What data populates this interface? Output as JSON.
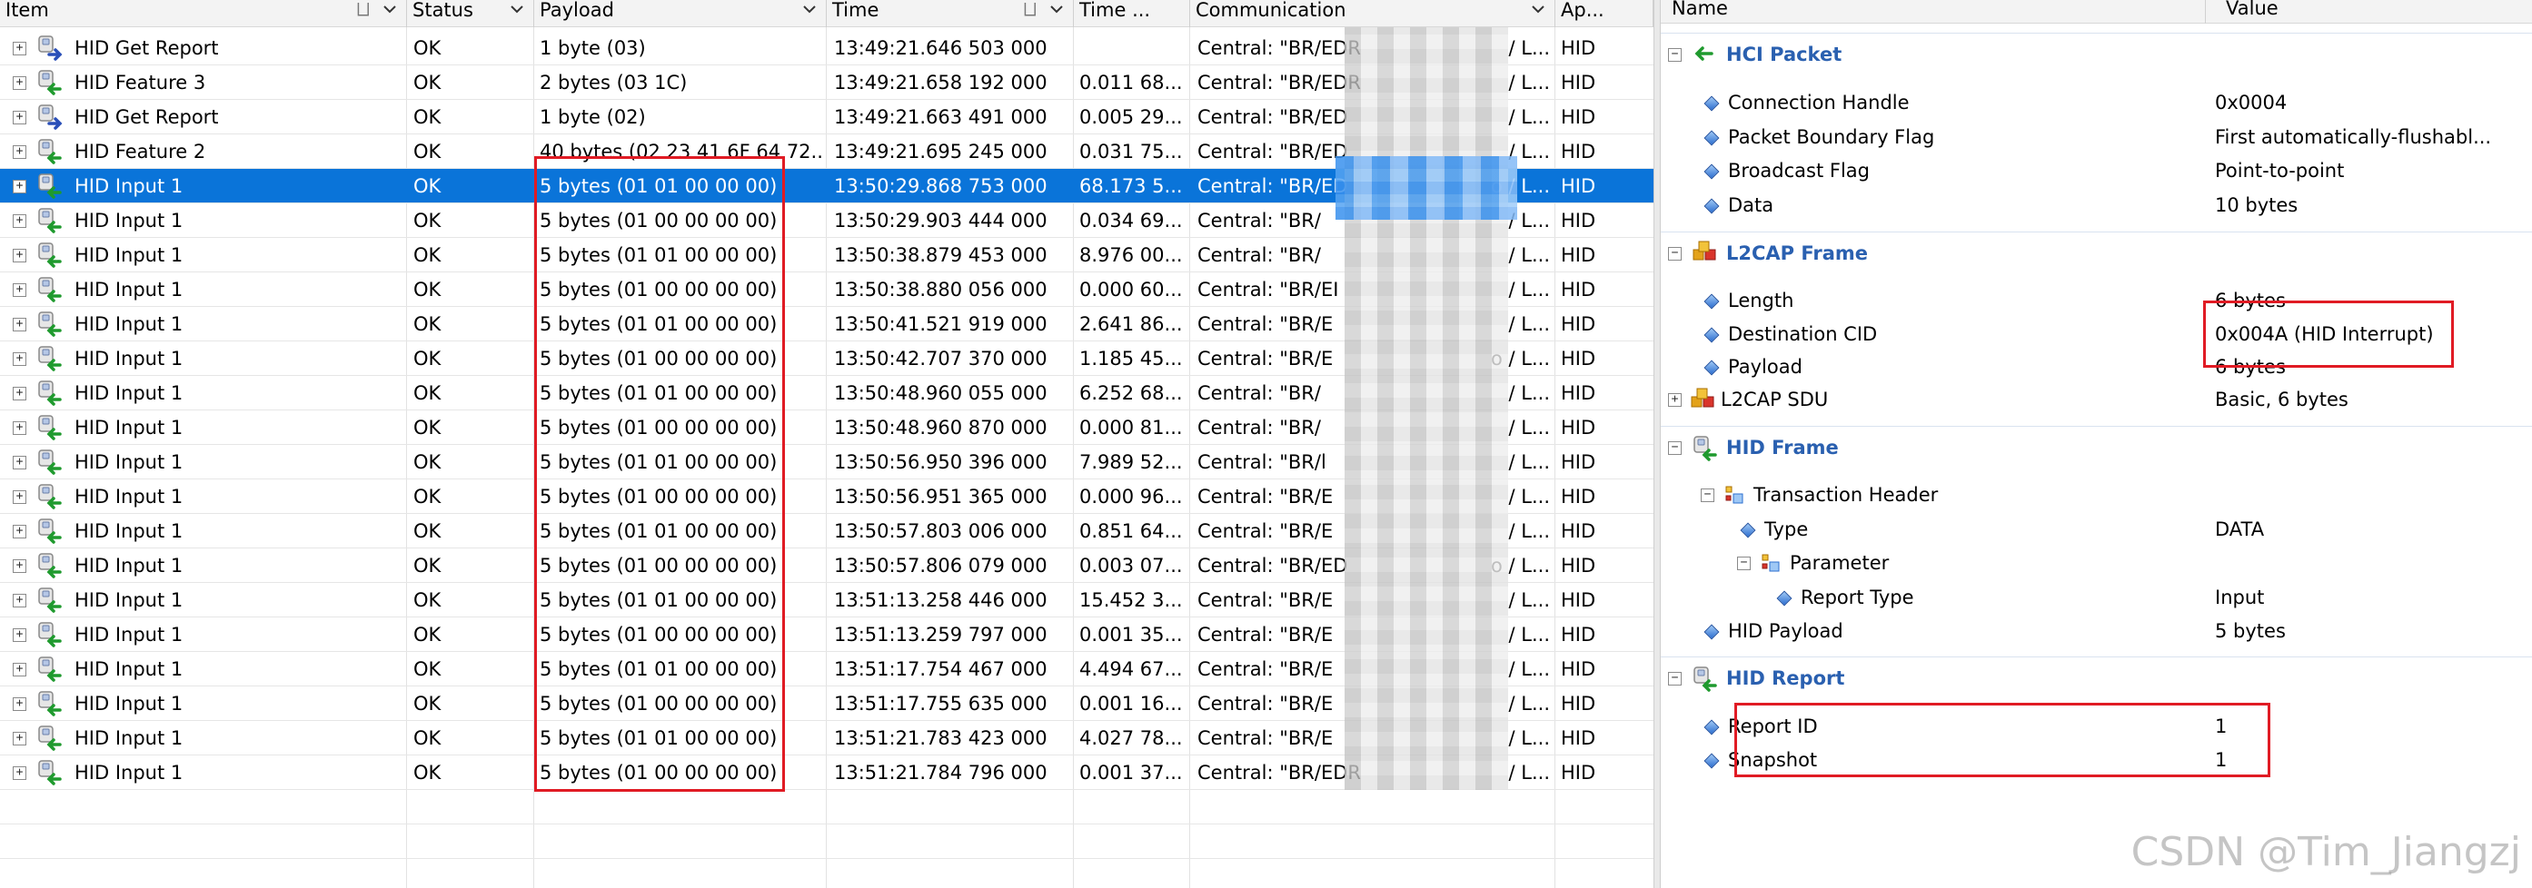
{
  "table": {
    "columns": [
      {
        "key": "item",
        "label": "Item"
      },
      {
        "key": "status",
        "label": "Status"
      },
      {
        "key": "payload",
        "label": "Payload"
      },
      {
        "key": "time",
        "label": "Time"
      },
      {
        "key": "delta",
        "label": "Time ..."
      },
      {
        "key": "comm",
        "label": "Communication"
      },
      {
        "key": "app",
        "label": "Ap..."
      }
    ],
    "rows": [
      {
        "item": "HID Get Report",
        "status": "OK",
        "payload": "1 byte (03)",
        "time": "13:49:21.646 503 000",
        "delta": "",
        "comm": "Central: \"BR/EDR",
        "comm_tail": "/ L...",
        "app": "HID",
        "dir": "out"
      },
      {
        "item": "HID Feature 3",
        "status": "OK",
        "payload": "2 bytes (03 1C)",
        "time": "13:49:21.658 192 000",
        "delta": "0.011 68...",
        "comm": "Central: \"BR/EDR",
        "comm_tail": "/ L...",
        "app": "HID",
        "dir": "in"
      },
      {
        "item": "HID Get Report",
        "status": "OK",
        "payload": "1 byte (02)",
        "time": "13:49:21.663 491 000",
        "delta": "0.005 29...",
        "comm": "Central: \"BR/ED",
        "comm_tail": "/ L...",
        "app": "HID",
        "dir": "out"
      },
      {
        "item": "HID Feature 2",
        "status": "OK",
        "payload": "40 bytes (02 23 41 6F 64 72...",
        "time": "13:49:21.695 245 000",
        "delta": "0.031 75...",
        "comm": "Central: \"BR/ED",
        "comm_tail": "/ L...",
        "app": "HID",
        "dir": "in"
      },
      {
        "item": "HID Input 1",
        "status": "OK",
        "payload": "5 bytes (01 01 00 00 00)",
        "time": "13:50:29.868 753 000",
        "delta": "68.173 5...",
        "comm": "Central: \"BR/ED",
        "comm_tail": "o / L...",
        "app": "HID",
        "dir": "in",
        "selected": true
      },
      {
        "item": "HID Input 1",
        "status": "OK",
        "payload": "5 bytes (01 00 00 00 00)",
        "time": "13:50:29.903 444 000",
        "delta": "0.034 69...",
        "comm": "Central: \"BR/",
        "comm_tail": "/ L...",
        "app": "HID",
        "dir": "in"
      },
      {
        "item": "HID Input 1",
        "status": "OK",
        "payload": "5 bytes (01 01 00 00 00)",
        "time": "13:50:38.879 453 000",
        "delta": "8.976 00...",
        "comm": "Central: \"BR/",
        "comm_tail": "/ L...",
        "app": "HID",
        "dir": "in"
      },
      {
        "item": "HID Input 1",
        "status": "OK",
        "payload": "5 bytes (01 00 00 00 00)",
        "time": "13:50:38.880 056 000",
        "delta": "0.000 60...",
        "comm": "Central: \"BR/EI",
        "comm_tail": "/ L...",
        "app": "HID",
        "dir": "in"
      },
      {
        "item": "HID Input 1",
        "status": "OK",
        "payload": "5 bytes (01 01 00 00 00)",
        "time": "13:50:41.521 919 000",
        "delta": "2.641 86...",
        "comm": "Central: \"BR/E",
        "comm_tail": "/ L...",
        "app": "HID",
        "dir": "in"
      },
      {
        "item": "HID Input 1",
        "status": "OK",
        "payload": "5 bytes (01 00 00 00 00)",
        "time": "13:50:42.707 370 000",
        "delta": "1.185 45...",
        "comm": "Central: \"BR/E",
        "comm_tail": "o / L...",
        "app": "HID",
        "dir": "in"
      },
      {
        "item": "HID Input 1",
        "status": "OK",
        "payload": "5 bytes (01 01 00 00 00)",
        "time": "13:50:48.960 055 000",
        "delta": "6.252 68...",
        "comm": "Central: \"BR/",
        "comm_tail": "/ L...",
        "app": "HID",
        "dir": "in"
      },
      {
        "item": "HID Input 1",
        "status": "OK",
        "payload": "5 bytes (01 00 00 00 00)",
        "time": "13:50:48.960 870 000",
        "delta": "0.000 81...",
        "comm": "Central: \"BR/",
        "comm_tail": "/ L...",
        "app": "HID",
        "dir": "in"
      },
      {
        "item": "HID Input 1",
        "status": "OK",
        "payload": "5 bytes (01 01 00 00 00)",
        "time": "13:50:56.950 396 000",
        "delta": "7.989 52...",
        "comm": "Central: \"BR/l",
        "comm_tail": "/ L...",
        "app": "HID",
        "dir": "in"
      },
      {
        "item": "HID Input 1",
        "status": "OK",
        "payload": "5 bytes (01 00 00 00 00)",
        "time": "13:50:56.951 365 000",
        "delta": "0.000 96...",
        "comm": "Central: \"BR/E",
        "comm_tail": "/ L...",
        "app": "HID",
        "dir": "in"
      },
      {
        "item": "HID Input 1",
        "status": "OK",
        "payload": "5 bytes (01 01 00 00 00)",
        "time": "13:50:57.803 006 000",
        "delta": "0.851 64...",
        "comm": "Central: \"BR/E",
        "comm_tail": "/ L...",
        "app": "HID",
        "dir": "in"
      },
      {
        "item": "HID Input 1",
        "status": "OK",
        "payload": "5 bytes (01 00 00 00 00)",
        "time": "13:50:57.806 079 000",
        "delta": "0.003 07...",
        "comm": "Central: \"BR/ED",
        "comm_tail": "o / L...",
        "app": "HID",
        "dir": "in"
      },
      {
        "item": "HID Input 1",
        "status": "OK",
        "payload": "5 bytes (01 01 00 00 00)",
        "time": "13:51:13.258 446 000",
        "delta": "15.452 3...",
        "comm": "Central: \"BR/E",
        "comm_tail": "/ L...",
        "app": "HID",
        "dir": "in"
      },
      {
        "item": "HID Input 1",
        "status": "OK",
        "payload": "5 bytes (01 00 00 00 00)",
        "time": "13:51:13.259 797 000",
        "delta": "0.001 35...",
        "comm": "Central: \"BR/E",
        "comm_tail": "/ L...",
        "app": "HID",
        "dir": "in"
      },
      {
        "item": "HID Input 1",
        "status": "OK",
        "payload": "5 bytes (01 01 00 00 00)",
        "time": "13:51:17.754 467 000",
        "delta": "4.494 67...",
        "comm": "Central: \"BR/E",
        "comm_tail": "/ L...",
        "app": "HID",
        "dir": "in"
      },
      {
        "item": "HID Input 1",
        "status": "OK",
        "payload": "5 bytes (01 00 00 00 00)",
        "time": "13:51:17.755 635 000",
        "delta": "0.001 16...",
        "comm": "Central: \"BR/E",
        "comm_tail": "/ L...",
        "app": "HID",
        "dir": "in"
      },
      {
        "item": "HID Input 1",
        "status": "OK",
        "payload": "5 bytes (01 01 00 00 00)",
        "time": "13:51:21.783 423 000",
        "delta": "4.027 78...",
        "comm": "Central: \"BR/E",
        "comm_tail": "/ L...",
        "app": "HID",
        "dir": "in"
      },
      {
        "item": "HID Input 1",
        "status": "OK",
        "payload": "5 bytes (01 00 00 00 00)",
        "time": "13:51:21.784 796 000",
        "delta": "0.001 37...",
        "comm": "Central: \"BR/EDR",
        "comm_tail": "/ L...",
        "app": "HID",
        "dir": "in"
      }
    ]
  },
  "details": {
    "columns": {
      "name": "Name",
      "value": "Value"
    },
    "rows": [
      {
        "kind": "section",
        "name": "HCI Packet",
        "value": "",
        "icon": "green-arrow-icon",
        "box": "−"
      },
      {
        "kind": "field",
        "level": 1,
        "name": "Connection Handle",
        "value": "0x0004"
      },
      {
        "kind": "field",
        "level": 1,
        "name": "Packet Boundary Flag",
        "value": "First automatically-flushabl..."
      },
      {
        "kind": "field",
        "level": 1,
        "name": "Broadcast Flag",
        "value": "Point-to-point"
      },
      {
        "kind": "field",
        "level": 1,
        "name": "Data",
        "value": "10 bytes"
      },
      {
        "kind": "section",
        "name": "L2CAP Frame",
        "value": "",
        "icon": "cubes-icon",
        "box": "−"
      },
      {
        "kind": "field",
        "level": 1,
        "name": "Length",
        "value": "6 bytes"
      },
      {
        "kind": "field",
        "level": 1,
        "name": "Destination CID",
        "value": "0x004A (HID Interrupt)"
      },
      {
        "kind": "field",
        "level": 1,
        "name": "Payload",
        "value": "6 bytes"
      },
      {
        "kind": "group",
        "level": 0,
        "name": "L2CAP SDU",
        "value": "Basic, 6 bytes",
        "icon": "cubes-icon",
        "box": "+"
      },
      {
        "kind": "section",
        "name": "HID Frame",
        "value": "",
        "icon": "hid-device-icon",
        "box": "−"
      },
      {
        "kind": "group",
        "level": 1,
        "name": "Transaction Header",
        "value": "",
        "icon": "bits-icon",
        "box": "−"
      },
      {
        "kind": "field",
        "level": 2,
        "name": "Type",
        "value": "DATA"
      },
      {
        "kind": "group",
        "level": 2,
        "name": "Parameter",
        "value": "",
        "icon": "bits-icon",
        "box": "−"
      },
      {
        "kind": "field",
        "level": 3,
        "name": "Report Type",
        "value": "Input"
      },
      {
        "kind": "field",
        "level": 1,
        "name": "HID Payload",
        "value": "5 bytes"
      },
      {
        "kind": "section",
        "name": "HID Report",
        "value": "",
        "icon": "hid-device-icon",
        "box": "−"
      },
      {
        "kind": "field",
        "level": 1,
        "name": "Report ID",
        "value": "1"
      },
      {
        "kind": "field",
        "level": 1,
        "name": "Snapshot",
        "value": "1"
      }
    ]
  },
  "watermark": "CSDN @Tim_Jiangzj",
  "colors": {
    "selection": "#0a74d9",
    "highlight": "#e01b24",
    "section": "#2a60b0"
  }
}
